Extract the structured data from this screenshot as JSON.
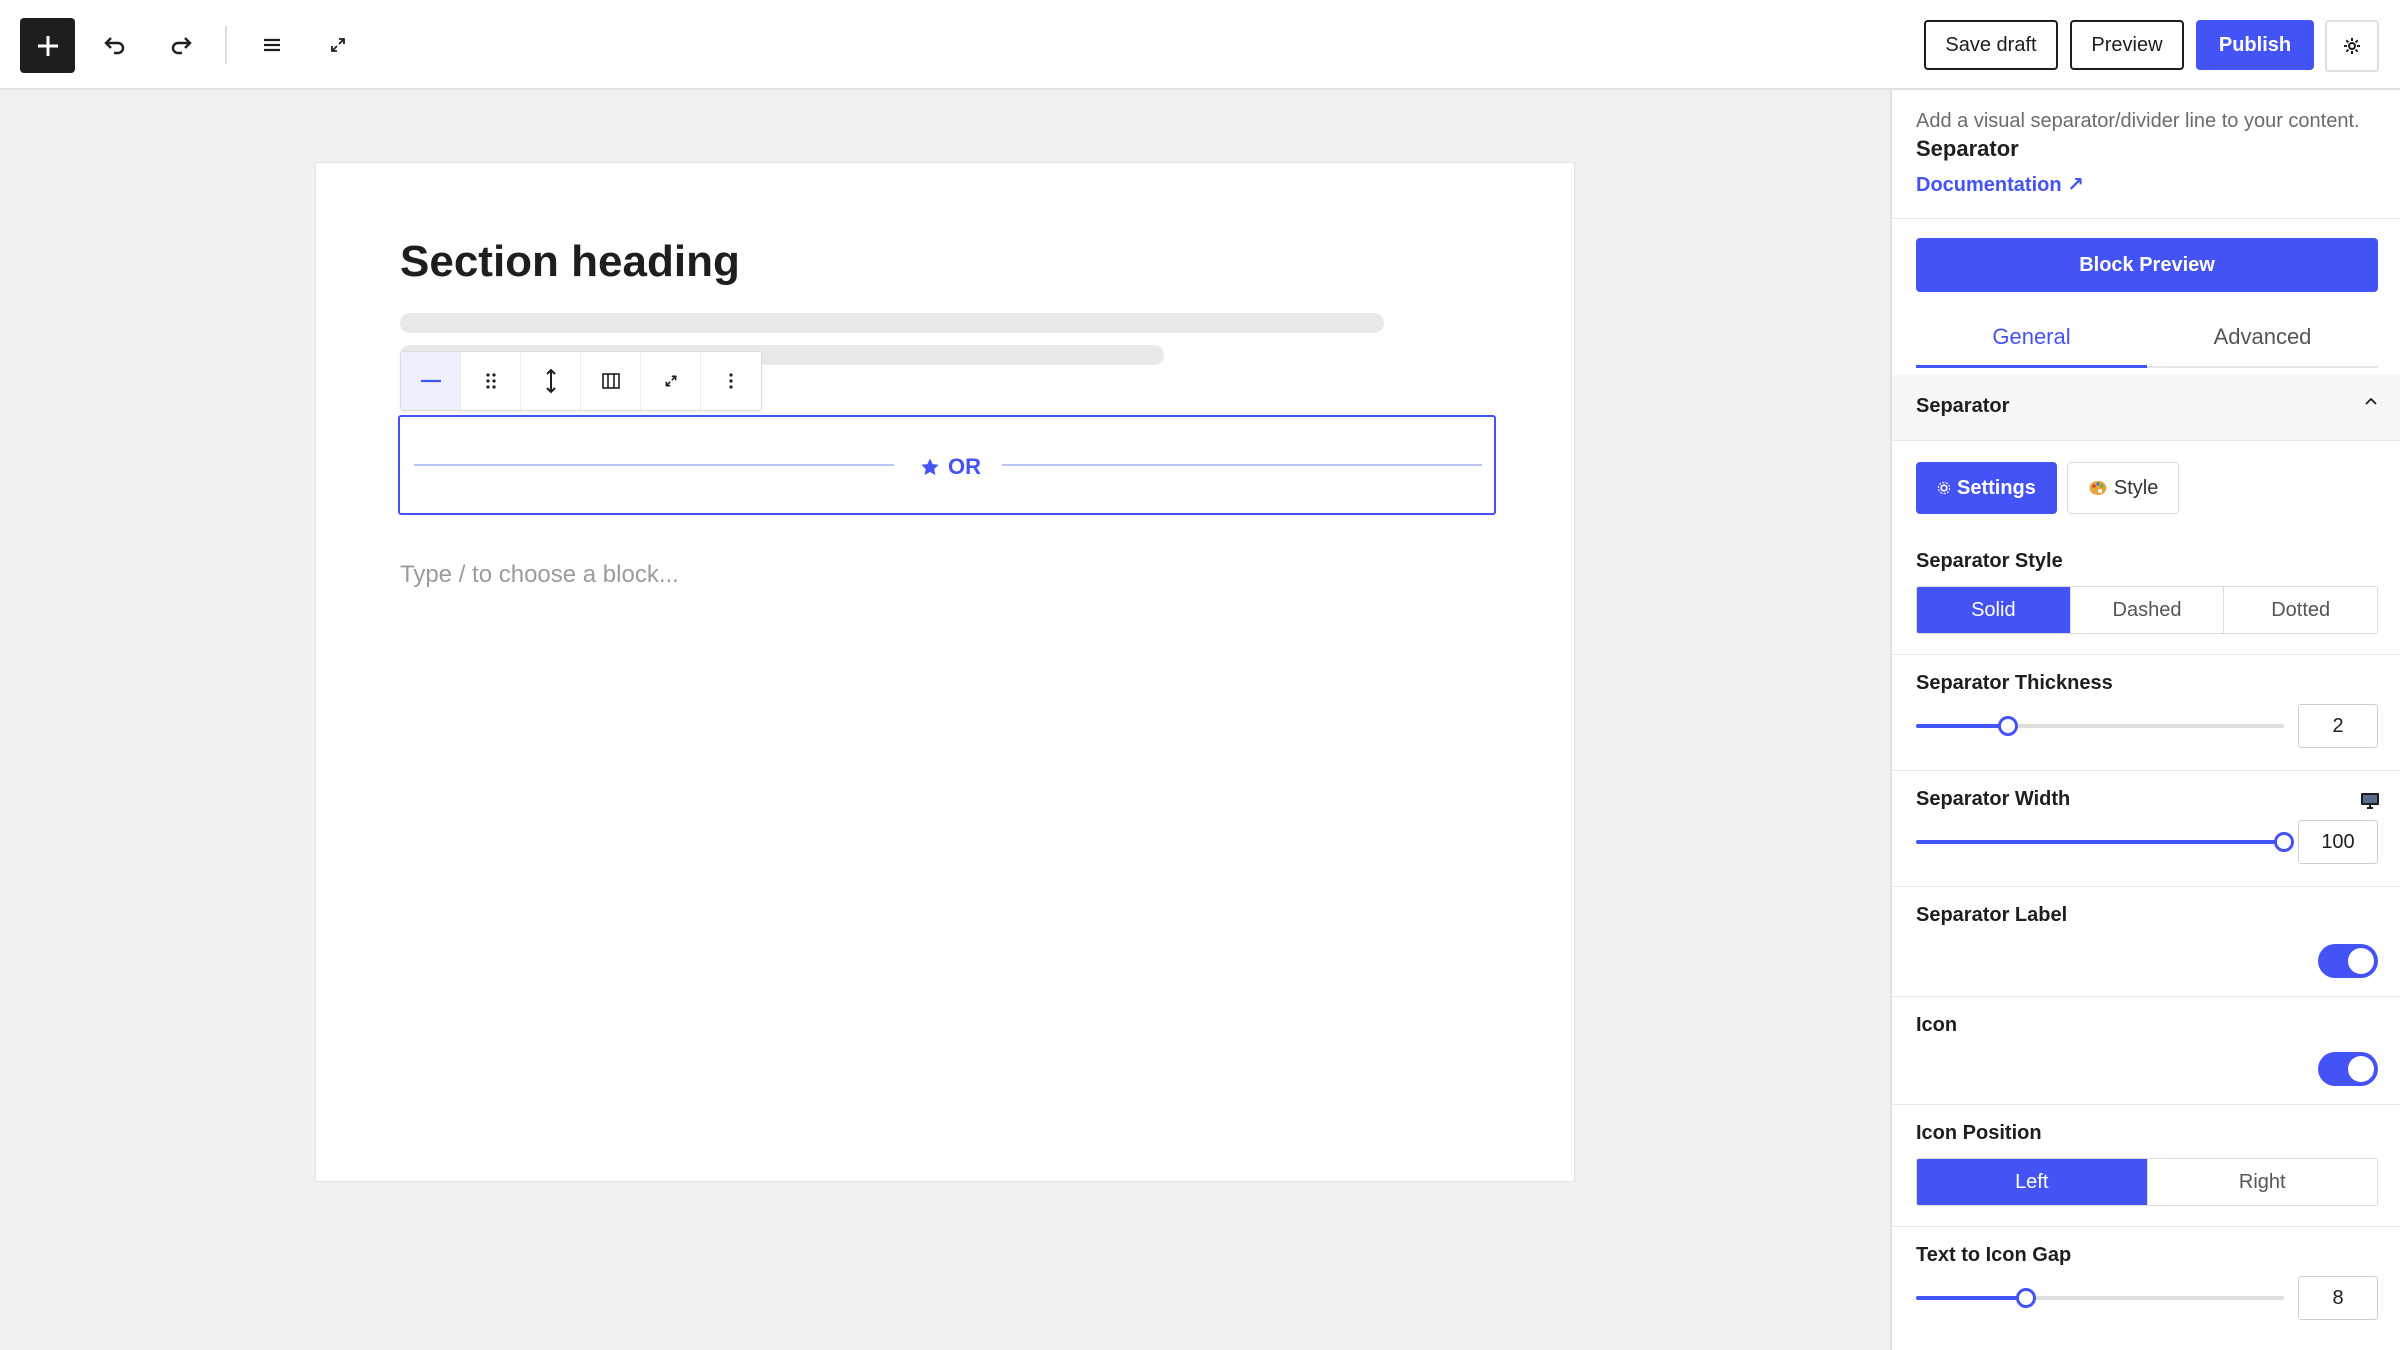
{
  "topbar": {
    "add_icon": "plus-icon",
    "undo_icon": "undo-icon",
    "redo_icon": "redo-icon",
    "list_icon": "list-view-icon",
    "fullscreen_icon": "expand-icon",
    "save_draft": "Save draft",
    "preview": "Preview",
    "publish": "Publish",
    "settings_icon": "gear-icon"
  },
  "editor": {
    "heading": "Section heading",
    "separator_label": "OR",
    "placeholder": "Type / to choose a block..."
  },
  "sidebar": {
    "description": "Add a visual separator/divider line to your content.",
    "block_name": "Separator",
    "documentation": "Documentation ↗",
    "block_preview": "Block Preview",
    "tabs": [
      {
        "label": "General",
        "active": true
      },
      {
        "label": "Advanced",
        "active": false
      }
    ],
    "panel_title": "Separator",
    "subtabs": [
      {
        "label": "Settings",
        "icon": "gear-icon",
        "active": true
      },
      {
        "label": "Style",
        "icon": "palette-icon",
        "active": false
      }
    ],
    "separator_style": {
      "label": "Separator Style",
      "options": [
        "Solid",
        "Dashed",
        "Dotted"
      ],
      "selected": "Solid"
    },
    "thickness": {
      "label": "Separator Thickness",
      "value": "2",
      "fraction": 0.25
    },
    "width": {
      "label": "Separator Width",
      "value": "100",
      "fraction": 1.0
    },
    "separator_label": {
      "label": "Separator Label",
      "enabled": true
    },
    "icon": {
      "label": "Icon",
      "enabled": true
    },
    "icon_position": {
      "label": "Icon Position",
      "options": [
        "Left",
        "Right"
      ],
      "selected": "Left"
    },
    "icon_gap": {
      "label": "Text to Icon Gap",
      "value": "8",
      "fraction": 0.3
    }
  },
  "colors": {
    "accent": "#4353f5",
    "canvas_bg": "#f0f0f0",
    "separator_line": "#b9c1f7"
  }
}
